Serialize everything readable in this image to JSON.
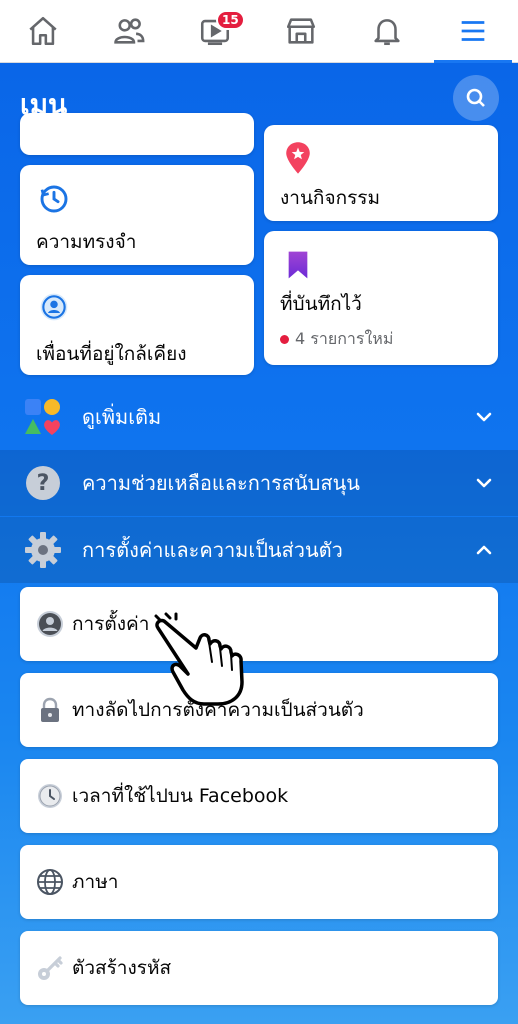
{
  "nav": {
    "items": [
      {
        "name": "home-icon"
      },
      {
        "name": "friends-icon"
      },
      {
        "name": "watch-icon",
        "badge": "15"
      },
      {
        "name": "marketplace-icon"
      },
      {
        "name": "notifications-icon"
      },
      {
        "name": "menu-icon",
        "active": true
      }
    ],
    "watch_badge": "15"
  },
  "menu": {
    "title": "เมนู",
    "search_icon": "search-icon"
  },
  "shortcuts": {
    "left": [
      {
        "label": "ความทรงจำ",
        "icon": "memories-icon"
      },
      {
        "label": "เพื่อนที่อยู่ใกล้เคียง",
        "icon": "nearby-friends-icon"
      }
    ],
    "right": [
      {
        "label": "งานกิจกรรม",
        "icon": "events-icon"
      },
      {
        "label": "ที่บันทึกไว้",
        "icon": "saved-icon",
        "sub": "4 รายการใหม่"
      }
    ]
  },
  "sections": {
    "see_more": "ดูเพิ่มเติม",
    "help": "ความช่วยเหลือและการสนับสนุน",
    "settings_privacy": "การตั้งค่าและความเป็นส่วนตัว"
  },
  "settings_items": [
    {
      "label": "การตั้งค่า",
      "icon": "account-icon"
    },
    {
      "label": "ทางลัดไปการตั้งค่าความเป็นส่วนตัว",
      "icon": "lock-icon"
    },
    {
      "label": "เวลาที่ใช้ไปบน Facebook",
      "icon": "clock-icon"
    },
    {
      "label": "ภาษา",
      "icon": "globe-icon"
    },
    {
      "label": "ตัวสร้างรหัส",
      "icon": "key-icon"
    }
  ],
  "colors": {
    "brand": "#1877f2",
    "badge": "#e41e3f"
  }
}
